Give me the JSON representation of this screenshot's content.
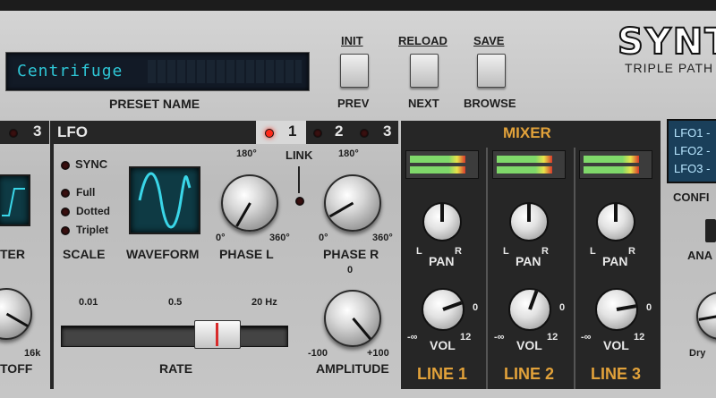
{
  "top": {
    "preset_name_value": "Centrifuge",
    "preset_name_label": "PRESET NAME",
    "buttons": {
      "init": "INIT",
      "reload": "RELOAD",
      "save": "SAVE",
      "prev": "PREV",
      "next": "NEXT",
      "browse": "BROWSE"
    },
    "brand_title": "SYNT",
    "brand_subtitle": "TRIPLE PATH"
  },
  "left_filter": {
    "header_number": "3",
    "label_partial": "TER",
    "cutoff_label": "TOFF",
    "scale_16k": "16k"
  },
  "lfo": {
    "header": "LFO",
    "tabs": [
      "1",
      "2",
      "3"
    ],
    "active_tab": "1",
    "sync": "SYNC",
    "scale_options": [
      "Full",
      "Dotted",
      "Triplet"
    ],
    "scale_label": "SCALE",
    "waveform_label": "WAVEFORM",
    "phase_l": {
      "label": "PHASE L",
      "top": "180°",
      "left": "0°",
      "right": "360°"
    },
    "link": "LINK",
    "phase_r": {
      "label": "PHASE R",
      "top": "180°",
      "left": "0°",
      "right": "360°"
    },
    "rate": {
      "label": "RATE",
      "ticks": [
        "0.01",
        "0.5",
        "20 Hz"
      ],
      "position": 0.62
    },
    "amplitude": {
      "label": "AMPLITUDE",
      "top": "0",
      "min": "-100",
      "max": "+100"
    }
  },
  "mixer": {
    "title": "MIXER",
    "lines": [
      {
        "name": "LINE 1",
        "pan": "PAN",
        "vol": "VOL",
        "l": "L",
        "r": "R",
        "inf": "-∞",
        "zero": "0",
        "twelve": "12"
      },
      {
        "name": "LINE 2",
        "pan": "PAN",
        "vol": "VOL",
        "l": "L",
        "r": "R",
        "inf": "-∞",
        "zero": "0",
        "twelve": "12"
      },
      {
        "name": "LINE 3",
        "pan": "PAN",
        "vol": "VOL",
        "l": "L",
        "r": "R",
        "inf": "-∞",
        "zero": "0",
        "twelve": "12"
      }
    ],
    "meter_channels": [
      "L",
      "R"
    ]
  },
  "right": {
    "lfo_routes": [
      "LFO1 -",
      "LFO2 -",
      "LFO3 -"
    ],
    "config_label": "CONFI",
    "ana_label": "ANA",
    "dry_label": "Dry"
  },
  "colors": {
    "lcd_text": "#2ec6d6",
    "mixer_accent": "#e2a23a",
    "led_on": "#ff2a1a"
  }
}
